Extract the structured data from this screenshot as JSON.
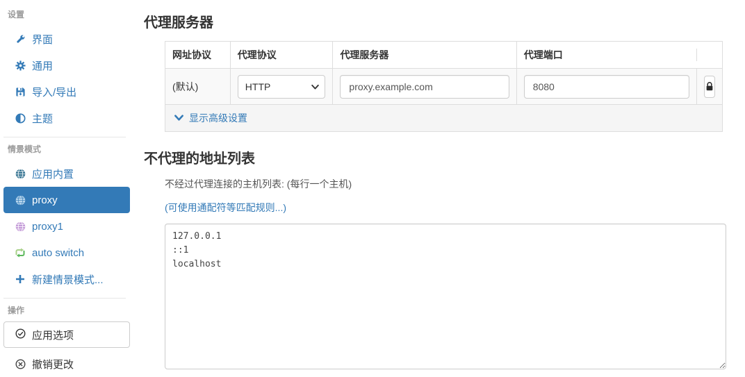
{
  "sidebar": {
    "sections": [
      {
        "label": "设置",
        "items": [
          {
            "label": "界面",
            "icon": "wrench-icon"
          },
          {
            "label": "通用",
            "icon": "gear-icon"
          },
          {
            "label": "导入/导出",
            "icon": "save-icon"
          },
          {
            "label": "主题",
            "icon": "contrast-icon"
          }
        ]
      },
      {
        "label": "情景模式",
        "items": [
          {
            "label": "应用内置",
            "icon": "globe-icon",
            "icon_color": "#31708f"
          },
          {
            "label": "proxy",
            "icon": "globe-icon",
            "icon_color": "#b9d7ee",
            "active": true
          },
          {
            "label": "proxy1",
            "icon": "globe-icon",
            "icon_color": "#c49bd8"
          },
          {
            "label": "auto switch",
            "icon": "retweet-icon"
          },
          {
            "label": "新建情景模式...",
            "icon": "plus-icon"
          }
        ]
      },
      {
        "label": "操作",
        "items": [
          {
            "label": "应用选项",
            "icon": "check-circle-icon"
          },
          {
            "label": "撤销更改",
            "icon": "x-circle-icon"
          }
        ]
      }
    ]
  },
  "main": {
    "proxy_section": {
      "title": "代理服务器",
      "table": {
        "headers": [
          "网址协议",
          "代理协议",
          "代理服务器",
          "代理端口"
        ],
        "row": {
          "scheme": "(默认)",
          "protocol": "HTTP",
          "server": "proxy.example.com",
          "port": "8080"
        }
      },
      "advanced_link": "显示高级设置"
    },
    "bypass_section": {
      "title": "不代理的地址列表",
      "description": "不经过代理连接的主机列表: (每行一个主机)",
      "wildcard_link": "(可使用通配符等匹配规则...)",
      "list": "127.0.0.1\n::1\nlocalhost"
    }
  },
  "colors": {
    "accent": "#337ab7",
    "active_item_bg": "#337ab7",
    "active_item_text": "#ffffff",
    "builtin_profile_icon": "#31708f",
    "active_profile_icon": "#b9d7ee",
    "proxy1_profile_icon": "#c49bd8",
    "auto_switch_icon_light": "#a9d18a",
    "auto_switch_icon_dark": "#5cb85c",
    "lock_icon": "#2b2b2b"
  }
}
